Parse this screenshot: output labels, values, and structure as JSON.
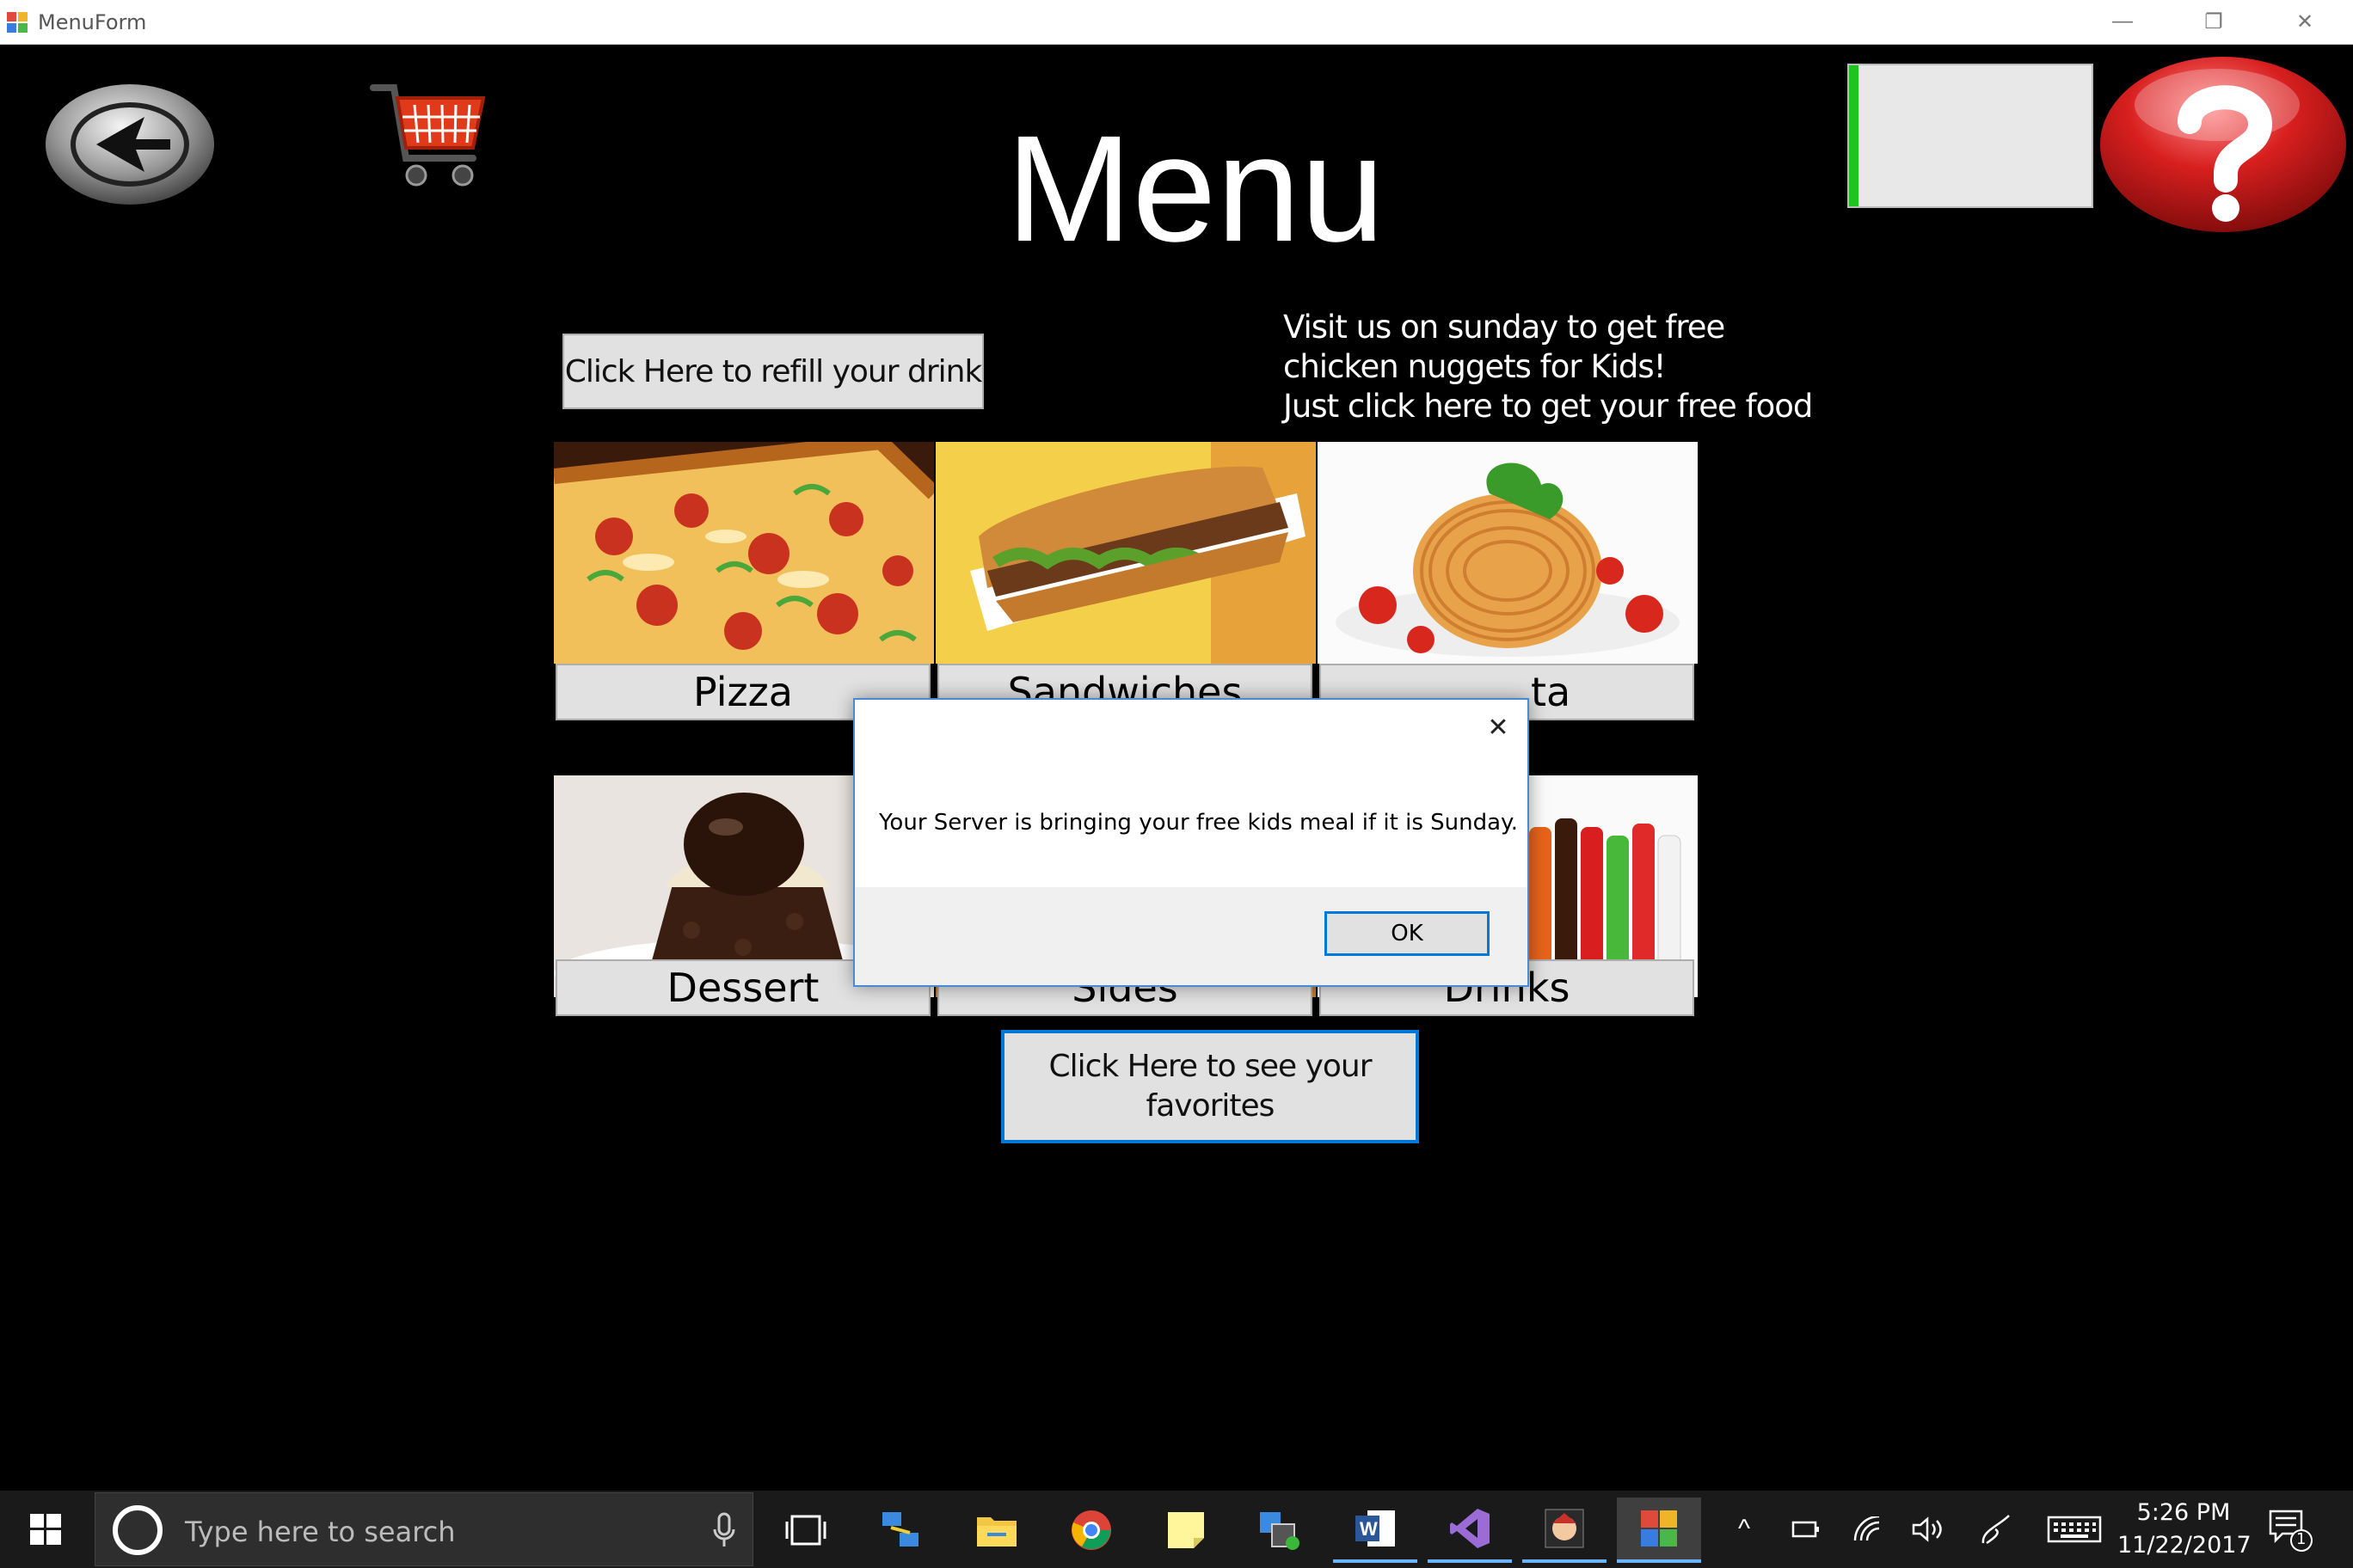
{
  "window": {
    "title": "MenuForm",
    "minimize_glyph": "—",
    "restore_glyph": "❐",
    "close_glyph": "✕"
  },
  "header": {
    "title": "Menu",
    "back_icon": "back-arrow-icon",
    "cart_icon": "shopping-cart-icon",
    "help_icon": "question-mark-icon",
    "progress_fraction": 0.04
  },
  "actions": {
    "refill_label": "Click Here to refill your drink",
    "favorites_label": "Click Here to see your favorites"
  },
  "promo": {
    "lines": [
      "Visit us on sunday to get free",
      "chicken nuggets for Kids!",
      "Just click here to get your free food"
    ]
  },
  "categories": [
    {
      "label": "Pizza"
    },
    {
      "label": "Sandwiches"
    },
    {
      "label": "Pasta"
    },
    {
      "label": "Dessert"
    },
    {
      "label": "Sides"
    },
    {
      "label": "Drinks"
    }
  ],
  "visible_category_labels": {
    "pasta_partial": "ta"
  },
  "dialog": {
    "message": "Your Server is bringing your free kids meal if it is Sunday.",
    "ok_label": "OK",
    "close_glyph": "✕"
  },
  "taskbar": {
    "search_placeholder": "Type here to search",
    "time": "5:26 PM",
    "date": "11/22/2017",
    "notification_count": "1",
    "tray_chevron": "^"
  },
  "colors": {
    "accent": "#0078d7",
    "progress": "#1ec51e",
    "button_face": "#e1e1e1",
    "help_red": "#d81f1f"
  }
}
